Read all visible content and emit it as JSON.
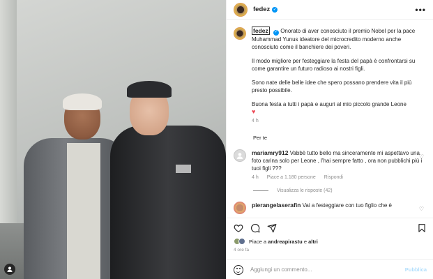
{
  "post": {
    "username": "fedez",
    "more_icon": "more-horizontal-icon"
  },
  "caption": {
    "username": "fedez",
    "paragraphs": [
      "Onorato di aver conosciuto il premio Nobel per la pace Muhammad Yunus ideatore del microcredito moderno anche conosciuto come il banchiere dei poveri.",
      "Il modo migliore per festeggiare la festa del papà è confrontarsi su come garantire un futuro radioso ai nostri figli.",
      "Sono nate delle belle idee che spero possano prendere vita il più presto possibile.",
      "Buona festa a tutti i papà e auguri al mio piccolo grande Leone"
    ],
    "heart": "♥",
    "time": "4 h"
  },
  "see_translation": "Per te",
  "comments": [
    {
      "username": "mariamry912",
      "text": "Vabbè tutto bello ma sinceramente mi aspettavo una foto carina solo per Leone , l'hai sempre fatto , ora non pubblichi più i tuoi figli ???",
      "time": "4 h",
      "likes": "Piace a 1.180 persone",
      "reply": "Rispondi",
      "view_replies": "Visualizza le risposte (42)"
    },
    {
      "username": "pierangelaserafin",
      "text": "Vai a festeggiare con tuo figlio che è"
    }
  ],
  "likes": {
    "prefix": "Piace a",
    "user": "andreapirastu",
    "conj": "e",
    "others": "altri"
  },
  "post_time": "4 ore fa",
  "add_comment": {
    "placeholder": "Aggiungi un commento...",
    "publish": "Pubblica"
  }
}
